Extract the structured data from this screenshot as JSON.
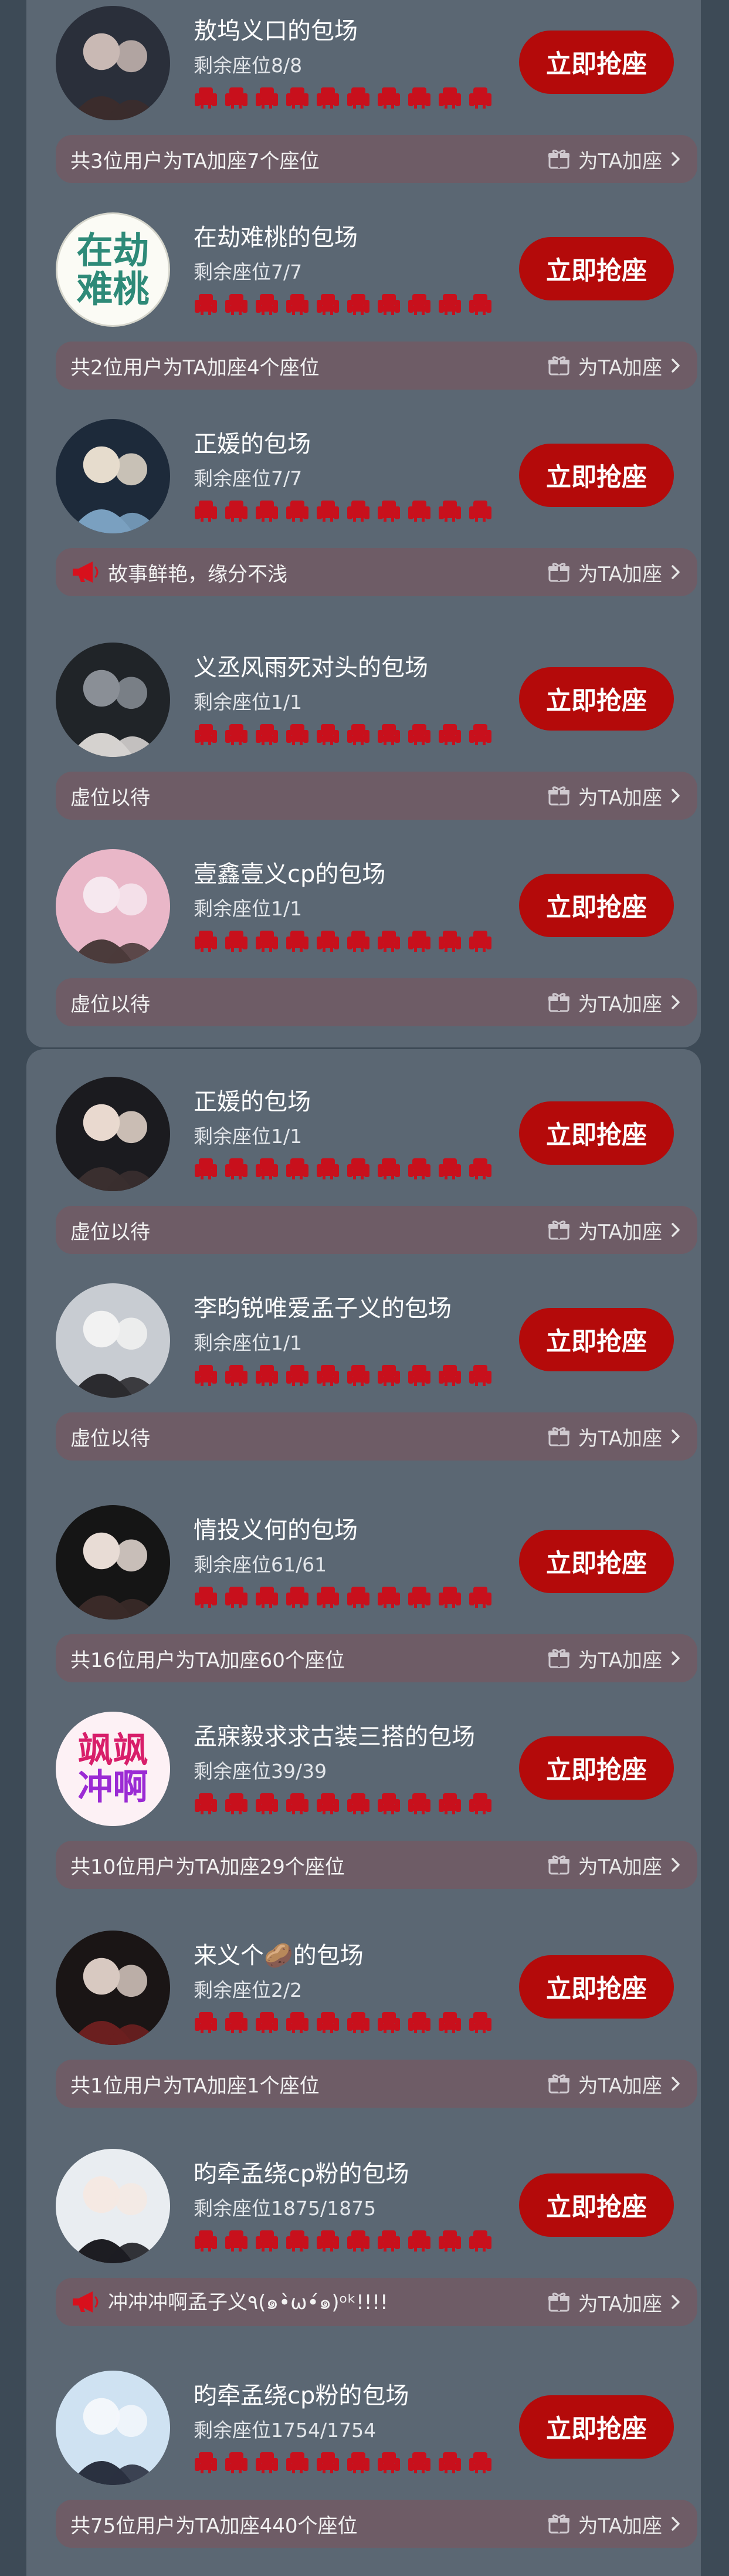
{
  "theme": {
    "page_bg": "#3d4a56",
    "panel_bg": "#5b6773",
    "button_red": "#b40a0a",
    "seat_red": "#c8101c",
    "info_bar_bg": "#6e5c66"
  },
  "add_seat_label": "为TA加座",
  "grab_button_label": "立即抢座",
  "seat_icon_count": 10,
  "cards": [
    {
      "title": "敖坞义口的包场",
      "seats": "剩余座位8/8",
      "info": "共3位用户为TA加座7个座位",
      "info_icon": "",
      "avatar_text": []
    },
    {
      "title": "在劫难桃的包场",
      "seats": "剩余座位7/7",
      "info": "共2位用户为TA加座4个座位",
      "info_icon": "",
      "avatar_text": [
        "在劫",
        "难桃"
      ]
    },
    {
      "title": "正媛的包场",
      "seats": "剩余座位7/7",
      "info": "故事鲜艳，缘分不浅",
      "info_icon": "megaphone-icon",
      "avatar_text": []
    },
    {
      "title": "义丞风雨死对头的包场",
      "seats": "剩余座位1/1",
      "info": "虚位以待",
      "info_icon": "",
      "avatar_text": []
    },
    {
      "title": "壹鑫壹义cp的包场",
      "seats": "剩余座位1/1",
      "info": "虚位以待",
      "info_icon": "",
      "avatar_text": []
    },
    {
      "title": "正媛的包场",
      "seats": "剩余座位1/1",
      "info": "虚位以待",
      "info_icon": "",
      "avatar_text": []
    },
    {
      "title": "李昀锐唯爱孟子义的包场",
      "seats": "剩余座位1/1",
      "info": "虚位以待",
      "info_icon": "",
      "avatar_text": []
    },
    {
      "title": "情投义何的包场",
      "seats": "剩余座位61/61",
      "info": "共16位用户为TA加座60个座位",
      "info_icon": "",
      "avatar_text": []
    },
    {
      "title": "孟寐毅求求古装三搭的包场",
      "seats": "剩余座位39/39",
      "info": "共10位用户为TA加座29个座位",
      "info_icon": "",
      "avatar_text": [
        "飒飒",
        "冲啊"
      ]
    },
    {
      "title": "来义个🥔的包场",
      "seats": "剩余座位2/2",
      "info": "共1位用户为TA加座1个座位",
      "info_icon": "",
      "avatar_text": []
    },
    {
      "title": "昀牵孟绕cp粉的包场",
      "seats": "剩余座位1875/1875",
      "info": "冲冲冲啊孟子义٩(๑•̀ω•́๑)ᵒᵏ!!!!",
      "info_icon": "megaphone-icon",
      "avatar_text": []
    },
    {
      "title": "昀牵孟绕cp粉的包场",
      "seats": "剩余座位1754/1754",
      "info": "共75位用户为TA加座440个座位",
      "info_icon": "",
      "avatar_text": []
    }
  ]
}
